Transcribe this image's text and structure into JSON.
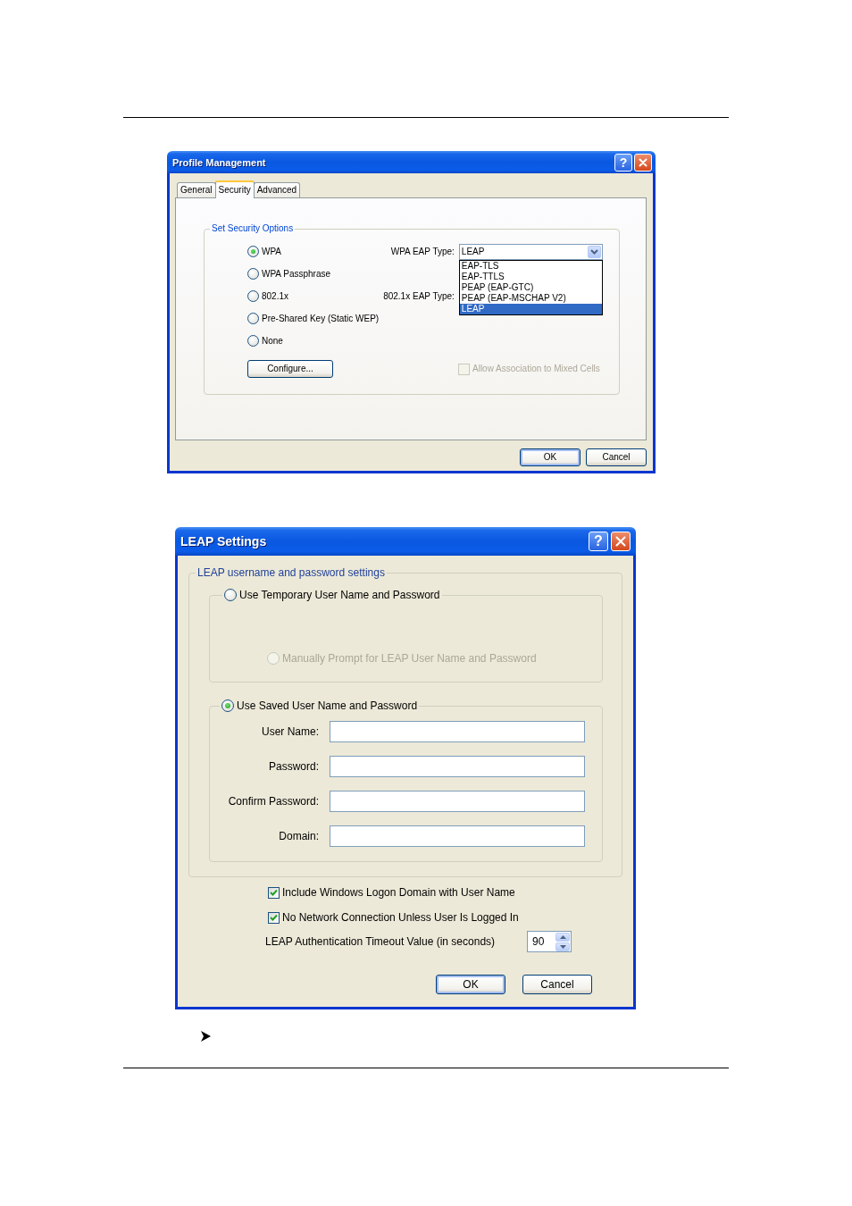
{
  "profile_dialog": {
    "title": "Profile Management",
    "help_button": "?",
    "tabs": [
      {
        "label": "General",
        "selected": false
      },
      {
        "label": "Security",
        "selected": true
      },
      {
        "label": "Advanced",
        "selected": false
      }
    ],
    "security_options": {
      "title": "Set Security Options",
      "options": [
        {
          "label": "WPA",
          "selected": true,
          "eap_type": {
            "label": "WPA EAP Type:",
            "value": "LEAP",
            "expanded": true,
            "options": [
              {
                "label": "EAP-TLS",
                "selected": false
              },
              {
                "label": "EAP-TTLS",
                "selected": false
              },
              {
                "label": "PEAP (EAP-GTC)",
                "selected": false
              },
              {
                "label": "PEAP (EAP-MSCHAP V2)",
                "selected": false
              },
              {
                "label": "LEAP",
                "selected": true
              }
            ]
          }
        },
        {
          "label": "WPA Passphrase",
          "selected": false
        },
        {
          "label": "802.1x",
          "selected": false,
          "eap_type": {
            "label": "802.1x EAP Type:"
          }
        },
        {
          "label": "Pre-Shared Key (Static WEP)",
          "selected": false
        },
        {
          "label": "None",
          "selected": false
        }
      ],
      "configure_button": "Configure...",
      "mixed_cells": {
        "label": "Allow Association to Mixed Cells",
        "checked": false,
        "disabled": true
      }
    },
    "buttons": [
      {
        "label": "OK",
        "default": true
      },
      {
        "label": "Cancel",
        "default": false
      }
    ]
  },
  "leap_dialog": {
    "title": "LEAP Settings",
    "help_button": "?",
    "credentials": {
      "title": "LEAP username and password settings",
      "temporary": {
        "label": "Use Temporary User Name and Password",
        "selected": false,
        "manual_prompt": {
          "label": "Manually Prompt for LEAP User Name and Password",
          "selected": false,
          "disabled": true
        }
      },
      "saved": {
        "label": "Use Saved User Name and Password",
        "selected": true,
        "fields": [
          {
            "label": "User Name:"
          },
          {
            "label": "Password:"
          },
          {
            "label": "Confirm Password:"
          },
          {
            "label": "Domain:"
          }
        ]
      }
    },
    "options": [
      {
        "label": "Include Windows Logon Domain with User Name",
        "checked": true
      },
      {
        "label": "No Network Connection Unless User Is Logged In",
        "checked": true
      }
    ],
    "timeout": {
      "label": "LEAP Authentication Timeout Value (in seconds)",
      "value": "90"
    },
    "buttons": [
      {
        "label": "OK",
        "default": true
      },
      {
        "label": "Cancel",
        "default": false
      }
    ]
  }
}
